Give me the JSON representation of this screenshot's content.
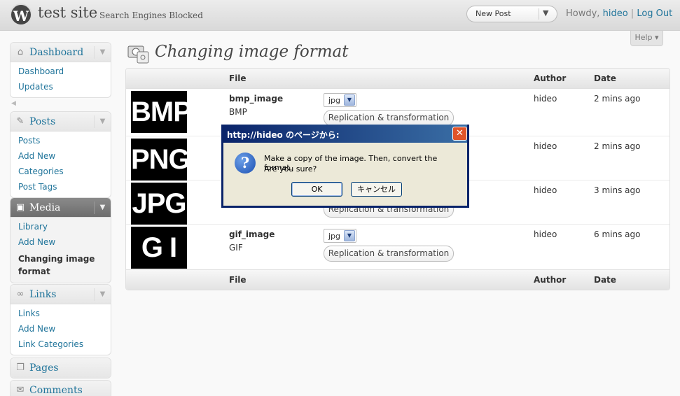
{
  "header": {
    "logo_letter": "W",
    "site_title": "test site",
    "site_subtitle": "Search Engines Blocked",
    "new_post_label": "New Post",
    "howdy_prefix": "Howdy,",
    "username": "hideo",
    "separator": "|",
    "logout_label": "Log Out",
    "help_label": "Help ▾"
  },
  "sidebar": {
    "groups": [
      {
        "label": "Dashboard",
        "icon": "home-icon",
        "items": [
          "Dashboard",
          "Updates"
        ]
      },
      {
        "label": "Posts",
        "icon": "pin-icon",
        "items": [
          "Posts",
          "Add New",
          "Categories",
          "Post Tags"
        ]
      },
      {
        "label": "Media",
        "icon": "camera-icon",
        "items": [
          "Library",
          "Add New",
          "Changing image format"
        ]
      },
      {
        "label": "Links",
        "icon": "chain-link-icon",
        "items": [
          "Links",
          "Add New",
          "Link Categories"
        ]
      },
      {
        "label": "Pages",
        "icon": "pages-icon",
        "items": []
      },
      {
        "label": "Comments",
        "icon": "comment-icon",
        "items": []
      }
    ]
  },
  "page": {
    "title": "Changing image format"
  },
  "table": {
    "columns": {
      "file": "File",
      "author": "Author",
      "date": "Date"
    },
    "rows": [
      {
        "thumb_text": "BMP",
        "name": "bmp_image",
        "type": "BMP",
        "format": "jpg",
        "action": "Replication & transformation",
        "author": "hideo",
        "date": "2 mins ago"
      },
      {
        "thumb_text": "PNG",
        "name": "",
        "type": "",
        "format": "",
        "action": "",
        "author": "hideo",
        "date": "2 mins ago"
      },
      {
        "thumb_text": "JPG",
        "name": "",
        "type": "",
        "format": "",
        "action": "Replication & transformation",
        "author": "hideo",
        "date": "3 mins ago"
      },
      {
        "thumb_text": "G I F",
        "name": "gif_image",
        "type": "GIF",
        "format": "jpg",
        "action": "Replication & transformation",
        "author": "hideo",
        "date": "6 mins ago"
      }
    ]
  },
  "dialog": {
    "title": "http://hideo のページから:",
    "close_glyph": "✕",
    "message_line1": "Make a copy of the image. Then, convert the format.",
    "message_line2": "Are you sure?",
    "ok_label": "OK",
    "cancel_label": "キャンセル"
  },
  "colors": {
    "link": "#21759b",
    "dialog_titlebar": "#0a246a",
    "dialog_body": "#ece9d8"
  }
}
